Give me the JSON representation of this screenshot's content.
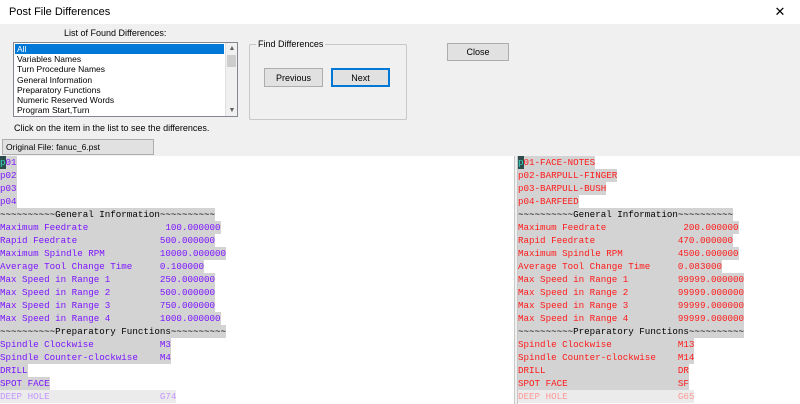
{
  "window": {
    "title": "Post File Differences",
    "close_glyph": "✕"
  },
  "list": {
    "label": "List of Found Differences:",
    "items": [
      "All",
      "Variables Names",
      "Turn Procedure Names",
      "General Information",
      "Preparatory Functions",
      "Numeric Reserved Words",
      "Program Start,Turn"
    ],
    "selected": "All",
    "hint": "Click on the item in the list to see the differences."
  },
  "find": {
    "legend": "Find Differences",
    "previous_label": "Previous",
    "next_label": "Next"
  },
  "close_label": "Close",
  "original_file_label": "Original File: fanuc_6.pst",
  "left_lines": [
    "p01",
    "p02",
    "p03",
    "p04",
    "~~~~~~~~~~General Information~~~~~~~~~~",
    "Maximum Feedrate              100.000000",
    "Rapid Feedrate               500.000000",
    "Maximum Spindle RPM          10000.000000",
    "Average Tool Change Time     0.100000",
    "Max Speed in Range 1         250.000000",
    "Max Speed in Range 2         500.000000",
    "Max Speed in Range 3         750.000000",
    "Max Speed in Range 4         1000.000000",
    "~~~~~~~~~~Preparatory Functions~~~~~~~~~~",
    "Spindle Clockwise            M3",
    "Spindle Counter-clockwise    M4",
    "DRILL",
    "SPOT FACE",
    "DEEP HOLE                    G74"
  ],
  "right_lines": [
    "p01-FACE-NOTES",
    "p02-BARPULL-FINGER",
    "p03-BARPULL-BUSH",
    "p04-BARFEED",
    "~~~~~~~~~~General Information~~~~~~~~~~",
    "Maximum Feedrate              200.000000",
    "Rapid Feedrate               470.000000",
    "Maximum Spindle RPM          4500.000000",
    "Average Tool Change Time     0.083000",
    "Max Speed in Range 1         99999.000000",
    "Max Speed in Range 2         99999.000000",
    "Max Speed in Range 3         99999.000000",
    "Max Speed in Range 4         99999.000000",
    "~~~~~~~~~~Preparatory Functions~~~~~~~~~~",
    "Spindle Clockwise            M13",
    "Spindle Counter-clockwise    M14",
    "DRILL                        DR",
    "SPOT FACE                    SF",
    "DEEP HOLE                    G65"
  ],
  "colors": {
    "left_text": "#7b14ff",
    "right_text": "#ff1a1a",
    "diff_bg": "#d3d3d3",
    "selection": "#0078d7"
  }
}
